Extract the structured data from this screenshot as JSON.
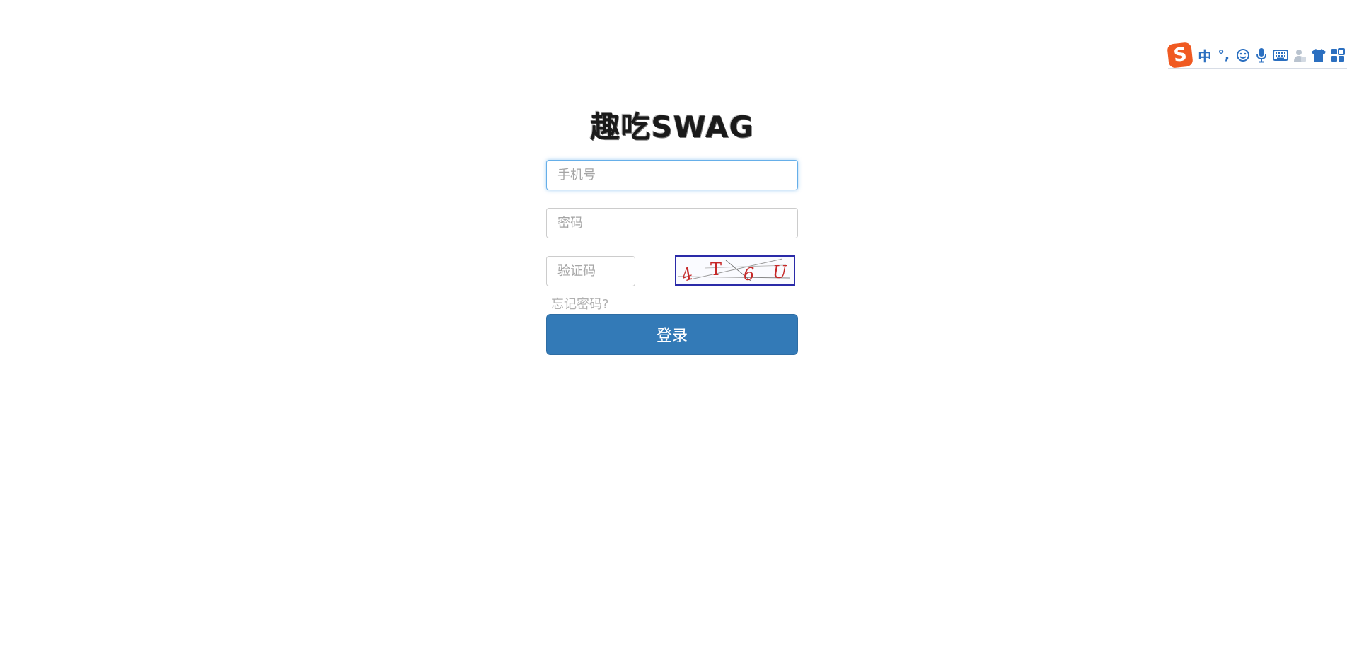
{
  "ime_toolbar": {
    "logo": "S",
    "items": [
      {
        "name": "chinese-mode",
        "label": "中"
      },
      {
        "name": "punctuation",
        "label": "°,"
      },
      {
        "name": "emoji-icon",
        "label": ""
      },
      {
        "name": "microphone-icon",
        "label": ""
      },
      {
        "name": "keyboard-icon",
        "label": ""
      },
      {
        "name": "user-icon",
        "label": ""
      },
      {
        "name": "skin-icon",
        "label": ""
      },
      {
        "name": "toolbox-icon",
        "label": ""
      }
    ]
  },
  "logo": {
    "text": "趣吃SWAG"
  },
  "form": {
    "phone_placeholder": "手机号",
    "password_placeholder": "密码",
    "captcha_placeholder": "验证码",
    "captcha_text": "4T6U",
    "forgot_label": "忘记密码?",
    "login_label": "登录"
  },
  "colors": {
    "primary_button": "#337ab7",
    "focus_border": "#66afe9",
    "ime_logo": "#f05a22",
    "ime_icons": "#2b6fc0",
    "captcha_border": "#2a2aa8",
    "captcha_text": "#c62828"
  }
}
